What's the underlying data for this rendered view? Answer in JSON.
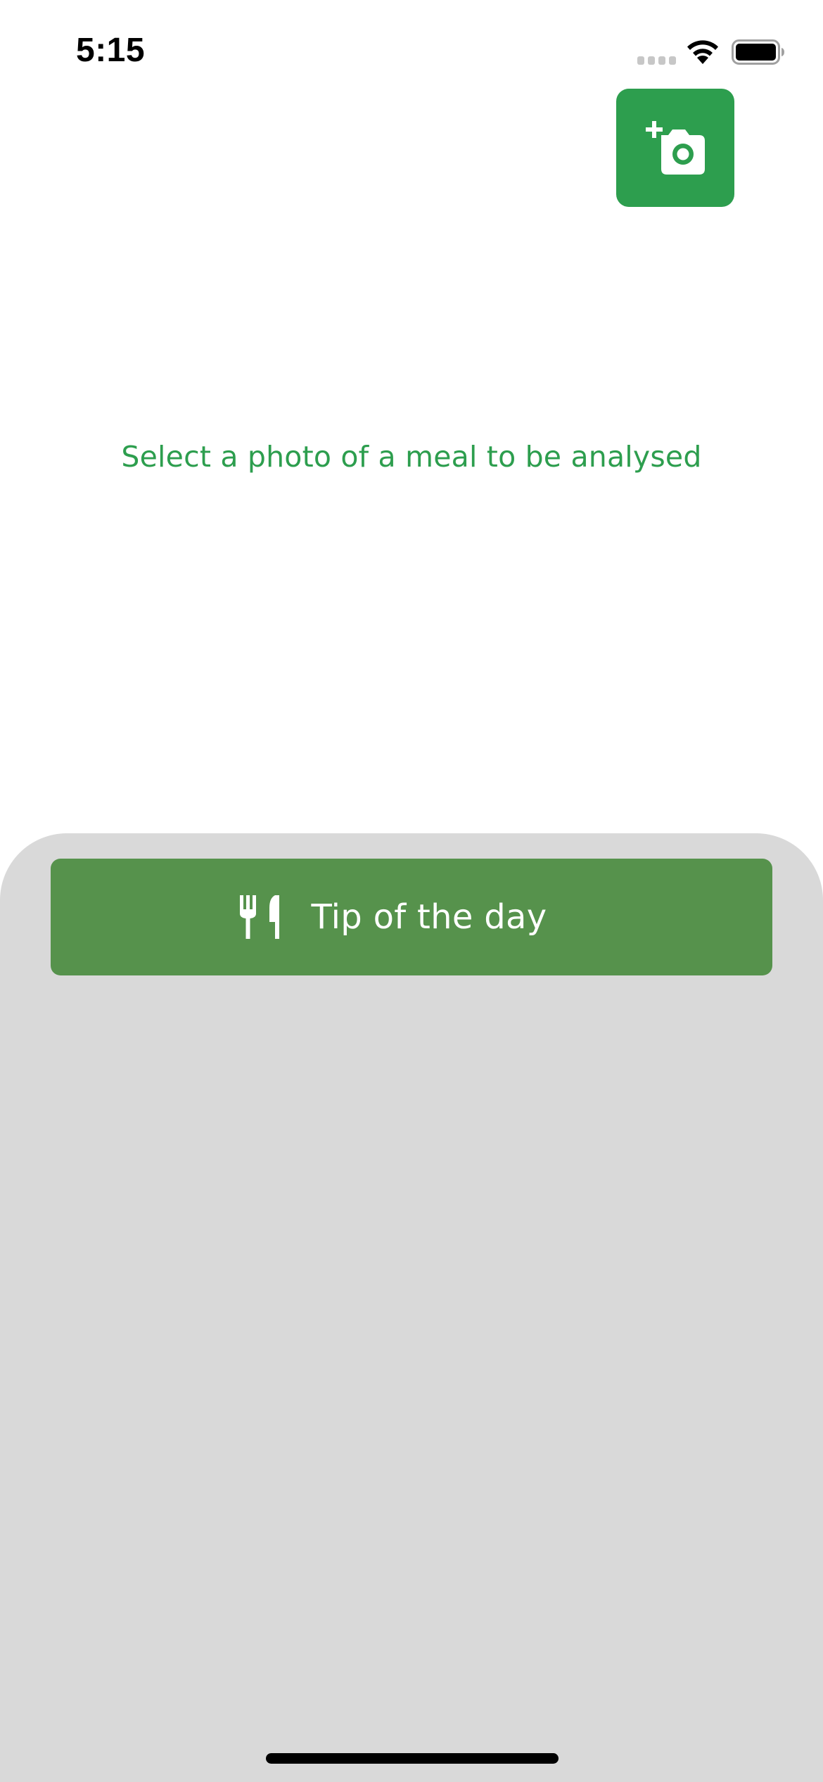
{
  "status_bar": {
    "time": "5:15"
  },
  "add_photo": {
    "icon": "add-a-photo-icon"
  },
  "main": {
    "prompt": "Select a photo of a meal to be analysed"
  },
  "bottom_sheet": {
    "tip_button_label": "Tip of the day",
    "tip_icon": "fork-knife-icon"
  },
  "colors": {
    "accent": "#2d9e4e",
    "tip_button": "#56924c",
    "sheet_background": "#d9d9d9"
  }
}
